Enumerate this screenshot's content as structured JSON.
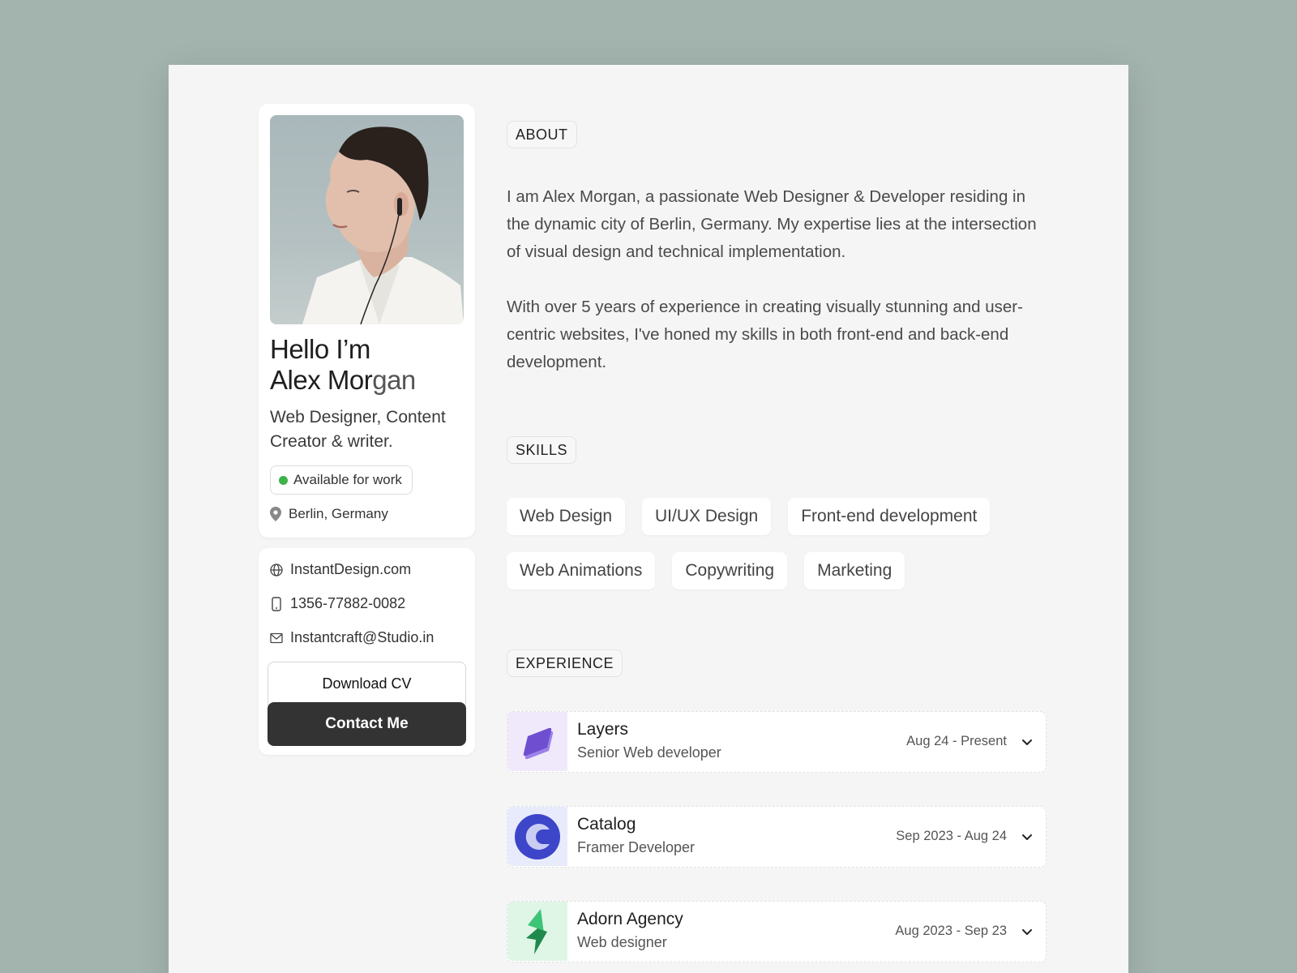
{
  "profile": {
    "greeting": "Hello I’m",
    "first_name": "Alex",
    "last_name_dark": "Mor",
    "last_name_light": "gan",
    "role": "Web Designer, Content Creator & writer.",
    "availability": "Available for work",
    "location": "Berlin, Germany"
  },
  "contact": {
    "website": "InstantDesign.com",
    "phone": "1356-77882-0082",
    "email": "Instantcraft@Studio.in",
    "download_label": "Download CV",
    "contact_label": "Contact Me"
  },
  "about": {
    "tag": "ABOUT",
    "paragraph_1": "I am Alex Morgan, a passionate Web Designer & Developer residing in the dynamic city of Berlin, Germany. My expertise lies at the intersection of visual design and technical implementation.",
    "paragraph_2": "With over 5 years of experience in creating visually stunning and user-centric websites, I've honed my skills in both front-end and back-end development."
  },
  "skills": {
    "tag": "SKILLS",
    "items": [
      "Web Design",
      "UI/UX Design",
      "Front-end development",
      "Web Animations",
      "Copywriting",
      "Marketing"
    ]
  },
  "experience": {
    "tag": "EXPERIENCE",
    "items": [
      {
        "company": "Layers",
        "position": "Senior Web developer",
        "dates": "Aug 24 - Present",
        "logo_icon": "layers-logo-icon",
        "logo_bg": "#efe9fb",
        "logo_color": "#7c5bd6"
      },
      {
        "company": "Catalog",
        "position": "Framer Developer",
        "dates": "Sep 2023 - Aug 24",
        "logo_icon": "catalog-logo-icon",
        "logo_bg": "#e8ebfb",
        "logo_color": "#3d46c9"
      },
      {
        "company": "Adorn Agency",
        "position": "Web designer",
        "dates": "Aug 2023 - Sep 23",
        "logo_icon": "adorn-logo-icon",
        "logo_bg": "#dff6e6",
        "logo_color": "#2e9e5a"
      }
    ]
  },
  "colors": {
    "background": "#a3b3ad",
    "page": "#f5f5f5",
    "status_green": "#3fb24a",
    "primary_button": "#333333"
  }
}
